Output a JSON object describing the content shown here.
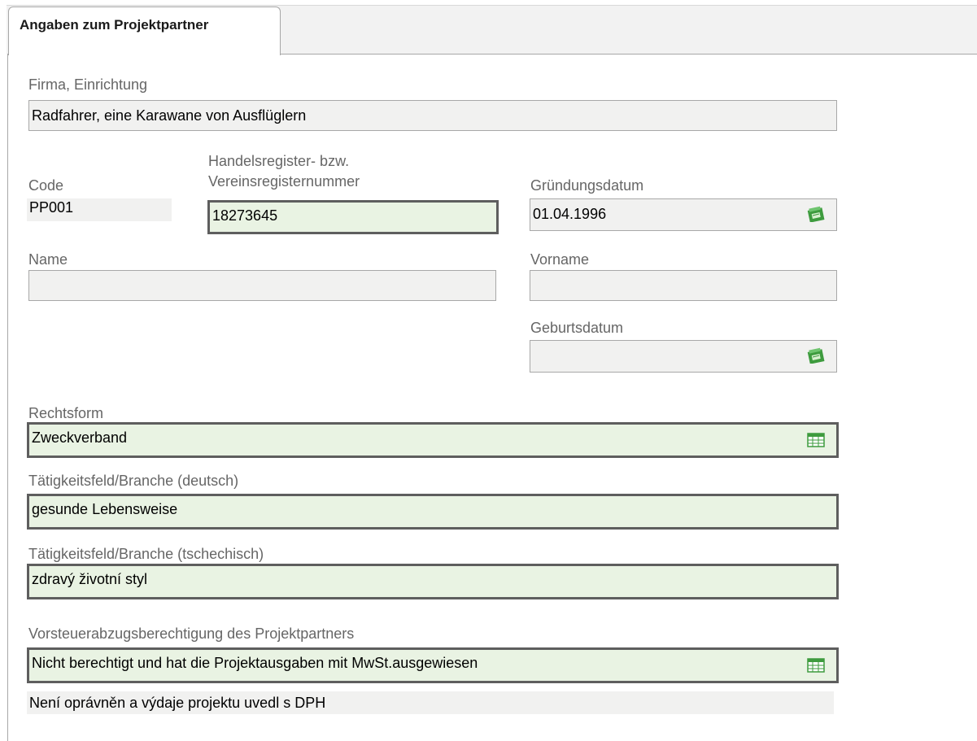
{
  "tab": {
    "label": "Angaben zum Projektpartner"
  },
  "firma": {
    "label": "Firma, Einrichtung",
    "value": "Radfahrer, eine Karawane von Ausflüglern"
  },
  "code": {
    "label": "Code",
    "value": "PP001"
  },
  "handelsregister": {
    "label_line1": "Handelsregister- bzw.",
    "label_line2": "Vereinsregisternummer",
    "value": "18273645"
  },
  "gruendungsdatum": {
    "label": "Gründungsdatum",
    "value": "01.04.1996",
    "icon": "calendar-icon"
  },
  "name": {
    "label": "Name",
    "value": ""
  },
  "vorname": {
    "label": "Vorname",
    "value": ""
  },
  "geburtsdatum": {
    "label": "Geburtsdatum",
    "value": "",
    "icon": "calendar-icon"
  },
  "rechtsform": {
    "label": "Rechtsform",
    "value": "Zweckverband",
    "icon": "list-picker-icon"
  },
  "taetigkeit_de": {
    "label": "Tätigkeitsfeld/Branche (deutsch)",
    "value": "gesunde Lebensweise"
  },
  "taetigkeit_cz": {
    "label": "Tätigkeitsfeld/Branche (tschechisch)",
    "value": "zdravý životní styl"
  },
  "vorsteuer": {
    "label": "Vorsteuerabzugsberechtigung des Projektpartners",
    "value": "Nicht berechtigt und hat die Projektausgaben mit MwSt.ausgewiesen",
    "translation": "Není oprávněn a výdaje projektu uvedl s DPH",
    "icon": "list-picker-icon"
  },
  "colors": {
    "readonly_bg": "#f1f1f0",
    "editable_bg": "#e9f3e3",
    "editable_border": "#5e5e5e",
    "label_text": "#666666",
    "icon_green": "#3e9b3e"
  }
}
